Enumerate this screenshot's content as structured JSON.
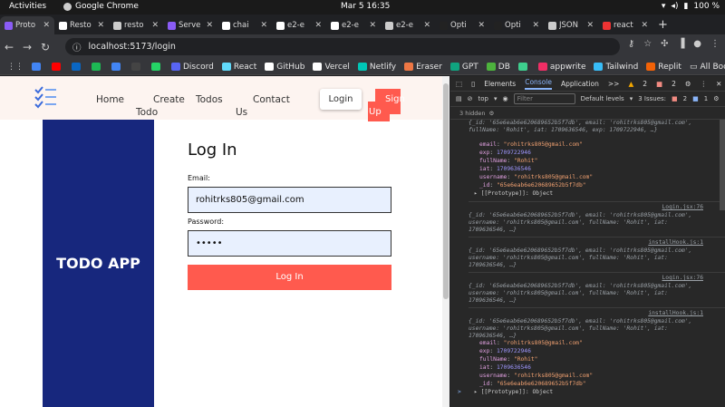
{
  "os_bar": {
    "activities": "Activities",
    "app": "Google Chrome",
    "clock": "Mar 5  16:35",
    "battery": "100 %"
  },
  "tabs": [
    {
      "title": "Proto",
      "color": "#8a5cf6",
      "active": true
    },
    {
      "title": "Resto",
      "color": "#fff"
    },
    {
      "title": "resto",
      "color": "#ccc"
    },
    {
      "title": "Serve",
      "color": "#8a5cf6"
    },
    {
      "title": "chai",
      "color": "#fff"
    },
    {
      "title": "e2-e",
      "color": "#fff"
    },
    {
      "title": "e2-e",
      "color": "#fff"
    },
    {
      "title": "e2-e",
      "color": "#ccc"
    },
    {
      "title": "Opti",
      "color": "#222"
    },
    {
      "title": "Opti",
      "color": "#222"
    },
    {
      "title": "JSON",
      "color": "#ccc"
    },
    {
      "title": "react",
      "color": "#e33"
    }
  ],
  "tab_close": "✕",
  "new_tab": "+",
  "url": "localhost:5173/login",
  "bookmarks": [
    {
      "label": "",
      "color": "#4285f4"
    },
    {
      "label": "",
      "color": "#ff0000"
    },
    {
      "label": "",
      "color": "#0a66c2"
    },
    {
      "label": "",
      "color": "#1db954"
    },
    {
      "label": "",
      "color": "#4285f4"
    },
    {
      "label": "",
      "color": "#444"
    },
    {
      "label": "",
      "color": "#25d366"
    },
    {
      "label": "Discord",
      "color": "#5865f2"
    },
    {
      "label": "React",
      "color": "#61dafb"
    },
    {
      "label": "GitHub",
      "color": "#fff"
    },
    {
      "label": "Vercel",
      "color": "#fff"
    },
    {
      "label": "Netlify",
      "color": "#00c7b7"
    },
    {
      "label": "Eraser",
      "color": "#e74"
    },
    {
      "label": "GPT",
      "color": "#10a37f"
    },
    {
      "label": "DB",
      "color": "#4db33d"
    },
    {
      "label": "",
      "color": "#3ecf8e"
    },
    {
      "label": "appwrite",
      "color": "#f02e65"
    },
    {
      "label": "Tailwind",
      "color": "#38bdf8"
    },
    {
      "label": "Replit",
      "color": "#f26207"
    }
  ],
  "all_bookmarks": "All Bookmarks",
  "site": {
    "nav": {
      "home": "Home",
      "create": "Create",
      "todo": "Todo",
      "todos": "Todos",
      "contact": "Contact",
      "us": "Us",
      "login": "Login",
      "sign": "Sign",
      "up": "Up"
    },
    "brand": "TODO APP",
    "form": {
      "title": "Log In",
      "email_label": "Email:",
      "email_value": "rohitrks805@gmail.com",
      "password_label": "Password:",
      "password_value": "•••••",
      "submit": "Log In"
    },
    "colors": {
      "brand_blue": "#17277d",
      "accent": "#ff5a4e",
      "input_bg": "#e8f0fe"
    }
  },
  "devtools": {
    "tabs": [
      "Elements",
      "Console",
      "Application",
      ">>"
    ],
    "active": "Console",
    "warn_count": "2",
    "err_count": "2",
    "context": "top",
    "filter": "Filter",
    "levels": "Default levels",
    "issues_label": "3 Issues:",
    "issues_count": "2",
    "issues_count2": "1",
    "hidden": "3 hidden",
    "lines": [
      {
        "type": "summary",
        "text": "{_id: '65e6eab6e620689652b5f7db', email: 'rohitrks805@gmail.com', fullName: 'Rohit', iat: 1709636546, exp: 1709722946, …}"
      },
      {
        "type": "kv",
        "k": "email",
        "v": "\"rohitrks805@gmail.com\"",
        "c": "s"
      },
      {
        "type": "kv",
        "k": "exp",
        "v": "1709722946",
        "c": "n"
      },
      {
        "type": "kv",
        "k": "fullName",
        "v": "\"Rohit\"",
        "c": "s"
      },
      {
        "type": "kv",
        "k": "iat",
        "v": "1709636546",
        "c": "n"
      },
      {
        "type": "kv",
        "k": "username",
        "v": "\"rohitrks805@gmail.com\"",
        "c": "s"
      },
      {
        "type": "kv",
        "k": "_id",
        "v": "\"65e6eab6e620689652b5f7db\"",
        "c": "s"
      },
      {
        "type": "proto",
        "text": "▸ [[Prototype]]: Object"
      },
      {
        "type": "src",
        "text": "Login.jsx:76"
      },
      {
        "type": "summary",
        "text": "{_id: '65e6eab6e620689652b5f7db', email: 'rohitrks805@gmail.com', username: 'rohitrks805@gmail.com', fullName: 'Rohit', iat: 1709636546, …}"
      },
      {
        "type": "src",
        "text": "installHook.js:1"
      },
      {
        "type": "summary",
        "text": "{_id: '65e6eab6e620689652b5f7db', email: 'rohitrks805@gmail.com', username: 'rohitrks805@gmail.com', fullName: 'Rohit', iat: 1709636546, …}"
      },
      {
        "type": "src",
        "text": "Login.jsx:76"
      },
      {
        "type": "summary",
        "text": "{_id: '65e6eab6e620689652b5f7db', email: 'rohitrks805@gmail.com', username: 'rohitrks805@gmail.com', fullName: 'Rohit', iat: 1709636546, …}"
      },
      {
        "type": "src",
        "text": "installHook.js:1"
      },
      {
        "type": "summary",
        "text": "{_id: '65e6eab6e620689652b5f7db', email: 'rohitrks805@gmail.com', username: 'rohitrks805@gmail.com', fullName: 'Rohit', iat: 1709636546, …}"
      },
      {
        "type": "kv",
        "k": "email",
        "v": "\"rohitrks805@gmail.com\"",
        "c": "s"
      },
      {
        "type": "kv",
        "k": "exp",
        "v": "1709722946",
        "c": "n"
      },
      {
        "type": "kv",
        "k": "fullName",
        "v": "\"Rohit\"",
        "c": "s"
      },
      {
        "type": "kv",
        "k": "iat",
        "v": "1709636546",
        "c": "n"
      },
      {
        "type": "kv",
        "k": "username",
        "v": "\"rohitrks805@gmail.com\"",
        "c": "s"
      },
      {
        "type": "kv",
        "k": "_id",
        "v": "\"65e6eab6e620689652b5f7db\"",
        "c": "s"
      },
      {
        "type": "proto",
        "text": "▸ [[Prototype]]: Object"
      }
    ],
    "prompt": ">"
  }
}
